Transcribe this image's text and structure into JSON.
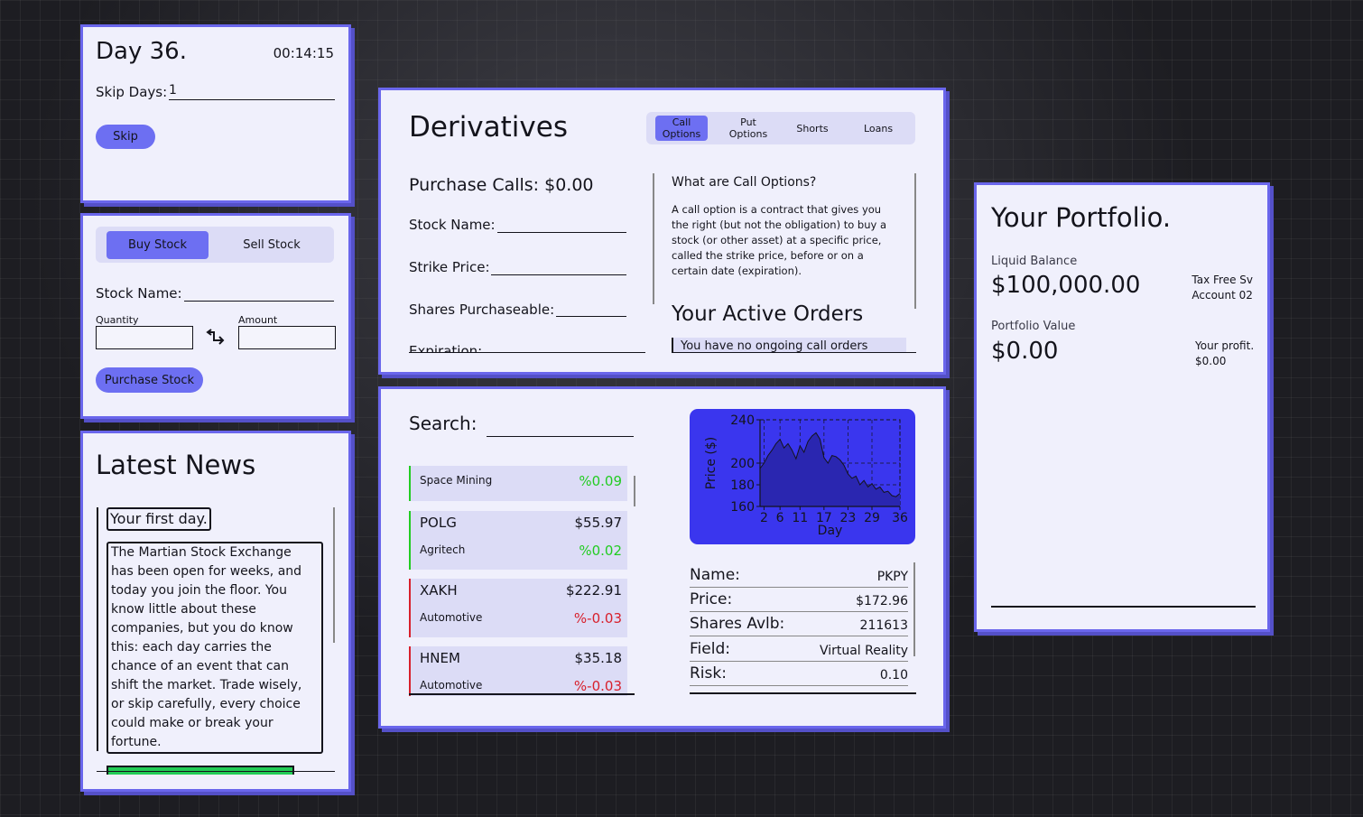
{
  "day_panel": {
    "title": "Day 36.",
    "clock": "00:14:15",
    "skip_label": "Skip Days:",
    "skip_value": "1",
    "skip_button": "Skip"
  },
  "trade_panel": {
    "tabs": [
      "Buy Stock",
      "Sell Stock"
    ],
    "active_tab": "Buy Stock",
    "stock_name_label": "Stock Name:",
    "quantity_label": "Quantity",
    "amount_label": "Amount",
    "swap_icon": "swap-arrows-icon",
    "purchase_button": "Purchase Stock"
  },
  "news_panel": {
    "title": "Latest News",
    "headline": "Your first day.",
    "body_lines": [
      "The Martian Stock Exchange",
      "has been open for weeks, and",
      "today you join the floor. You",
      "know little about these",
      "companies, but you do know",
      "this: each day carries the",
      "chance of an event that can",
      "shift the market. Trade wisely,",
      "or skip carefully, every choice",
      "could make or break your",
      "fortune."
    ]
  },
  "derivatives": {
    "title": "Derivatives",
    "tabs": [
      {
        "line1": "Call",
        "line2": "Options"
      },
      {
        "line1": "Put",
        "line2": "Options"
      },
      {
        "line1": "Shorts",
        "line2": ""
      },
      {
        "line1": "Loans",
        "line2": ""
      }
    ],
    "active_tab": "Call Options",
    "purchase_calls": "Purchase Calls: $0.00",
    "stock_name_label": "Stock Name:",
    "strike_price_label": "Strike Price:",
    "shares_purchaseable_label": "Shares Purchaseable:",
    "expiration_label": "Expiration:",
    "info_title": "What are Call Options?",
    "info_lines": [
      "A call option is a contract that gives you",
      "the right (but not the obligation) to buy a",
      "stock (or other asset) at a specific price,",
      "called the strike price, before or on a",
      "certain date (expiration)."
    ],
    "orders_title": "Your Active Orders",
    "orders_empty": "You have no ongoing call orders"
  },
  "market": {
    "search_label": "Search:",
    "stocks": [
      {
        "ticker": "",
        "price": "",
        "sector": "Space Mining",
        "change": "%0.09",
        "trend": "up"
      },
      {
        "ticker": "POLG",
        "price": "$55.97",
        "sector": "Agritech",
        "change": "%0.02",
        "trend": "up"
      },
      {
        "ticker": "XAKH",
        "price": "$222.91",
        "sector": "Automotive",
        "change": "%-0.03",
        "trend": "down"
      },
      {
        "ticker": "HNEM",
        "price": "$35.18",
        "sector": "Automotive",
        "change": "%-0.03",
        "trend": "down"
      }
    ],
    "details": [
      {
        "label": "Name:",
        "value": "PKPY"
      },
      {
        "label": "Price:",
        "value": "$172.96"
      },
      {
        "label": "Shares Avlb:",
        "value": "211613"
      },
      {
        "label": "Field:",
        "value": "Virtual Reality"
      },
      {
        "label": "Risk:",
        "value": "0.10"
      }
    ]
  },
  "chart_data": {
    "type": "area",
    "xlabel": "Day",
    "ylabel": "Price ($)",
    "xticks": [
      2,
      6,
      11,
      17,
      23,
      29,
      36
    ],
    "yticks": [
      160,
      180,
      200,
      240
    ],
    "xlim": [
      1,
      36
    ],
    "ylim": [
      160,
      240
    ],
    "grid": true,
    "x": [
      1,
      2,
      3,
      4,
      5,
      6,
      7,
      8,
      9,
      10,
      11,
      12,
      13,
      14,
      15,
      16,
      17,
      18,
      19,
      20,
      21,
      22,
      23,
      24,
      25,
      26,
      27,
      28,
      29,
      30,
      31,
      32,
      33,
      34,
      35,
      36
    ],
    "series": [
      {
        "name": "",
        "values": [
          195,
          200,
          207,
          212,
          218,
          222,
          214,
          218,
          212,
          204,
          216,
          210,
          220,
          225,
          228,
          222,
          205,
          200,
          207,
          206,
          203,
          198,
          190,
          186,
          188,
          180,
          184,
          178,
          181,
          176,
          178,
          173,
          174,
          170,
          169,
          172
        ]
      }
    ],
    "colors": {
      "background": "#3a36ee",
      "fill": "#2a26b0",
      "line": "#14141c"
    }
  },
  "portfolio": {
    "title": "Your Portfolio.",
    "liquid_label": "Liquid Balance",
    "liquid_value": "$100,000.00",
    "account_line1": "Tax Free Sv",
    "account_line2": "Account 02",
    "value_label": "Portfolio Value",
    "value_amount": "$0.00",
    "profit_label": "Your profit.",
    "profit_value": "$0.00"
  },
  "colors": {
    "panel_bg": "#f0f0fc",
    "accent": "#6a66ec",
    "up": "#22cc22",
    "down": "#d8202c"
  }
}
